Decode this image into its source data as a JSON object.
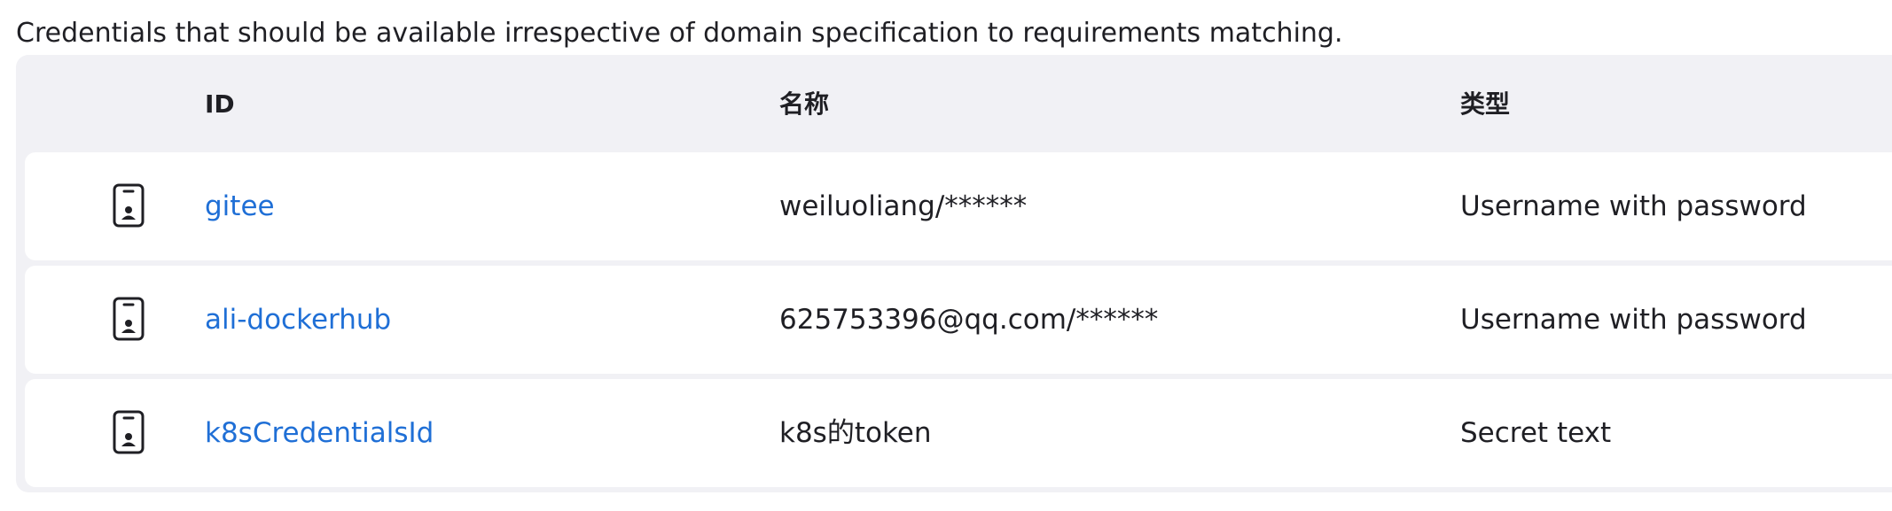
{
  "description": "Credentials that should be available irrespective of domain specification to requirements matching.",
  "table": {
    "headers": {
      "id": "ID",
      "name": "名称",
      "type": "类型"
    },
    "rows": [
      {
        "icon": "id-card-icon",
        "id": "gitee",
        "name": "weiluoliang/******",
        "type": "Username with password"
      },
      {
        "icon": "id-card-icon",
        "id": "ali-dockerhub",
        "name": "625753396@qq.com/******",
        "type": "Username with password"
      },
      {
        "icon": "id-card-icon",
        "id": "k8sCredentialsId",
        "name": "k8s的token",
        "type": "Secret text"
      }
    ]
  },
  "colors": {
    "link": "#1f6fd6",
    "frame": "#f1f1f5",
    "row": "#ffffff",
    "text": "#1f1f24"
  }
}
